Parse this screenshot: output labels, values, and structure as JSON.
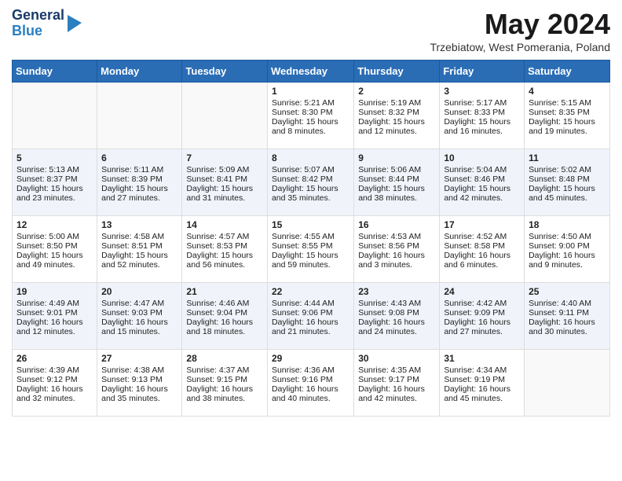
{
  "header": {
    "logo_general": "General",
    "logo_blue": "Blue",
    "title": "May 2024",
    "location": "Trzebiatow, West Pomerania, Poland"
  },
  "columns": [
    "Sunday",
    "Monday",
    "Tuesday",
    "Wednesday",
    "Thursday",
    "Friday",
    "Saturday"
  ],
  "weeks": [
    [
      {
        "day": "",
        "lines": []
      },
      {
        "day": "",
        "lines": []
      },
      {
        "day": "",
        "lines": []
      },
      {
        "day": "1",
        "lines": [
          "Sunrise: 5:21 AM",
          "Sunset: 8:30 PM",
          "Daylight: 15 hours",
          "and 8 minutes."
        ]
      },
      {
        "day": "2",
        "lines": [
          "Sunrise: 5:19 AM",
          "Sunset: 8:32 PM",
          "Daylight: 15 hours",
          "and 12 minutes."
        ]
      },
      {
        "day": "3",
        "lines": [
          "Sunrise: 5:17 AM",
          "Sunset: 8:33 PM",
          "Daylight: 15 hours",
          "and 16 minutes."
        ]
      },
      {
        "day": "4",
        "lines": [
          "Sunrise: 5:15 AM",
          "Sunset: 8:35 PM",
          "Daylight: 15 hours",
          "and 19 minutes."
        ]
      }
    ],
    [
      {
        "day": "5",
        "lines": [
          "Sunrise: 5:13 AM",
          "Sunset: 8:37 PM",
          "Daylight: 15 hours",
          "and 23 minutes."
        ]
      },
      {
        "day": "6",
        "lines": [
          "Sunrise: 5:11 AM",
          "Sunset: 8:39 PM",
          "Daylight: 15 hours",
          "and 27 minutes."
        ]
      },
      {
        "day": "7",
        "lines": [
          "Sunrise: 5:09 AM",
          "Sunset: 8:41 PM",
          "Daylight: 15 hours",
          "and 31 minutes."
        ]
      },
      {
        "day": "8",
        "lines": [
          "Sunrise: 5:07 AM",
          "Sunset: 8:42 PM",
          "Daylight: 15 hours",
          "and 35 minutes."
        ]
      },
      {
        "day": "9",
        "lines": [
          "Sunrise: 5:06 AM",
          "Sunset: 8:44 PM",
          "Daylight: 15 hours",
          "and 38 minutes."
        ]
      },
      {
        "day": "10",
        "lines": [
          "Sunrise: 5:04 AM",
          "Sunset: 8:46 PM",
          "Daylight: 15 hours",
          "and 42 minutes."
        ]
      },
      {
        "day": "11",
        "lines": [
          "Sunrise: 5:02 AM",
          "Sunset: 8:48 PM",
          "Daylight: 15 hours",
          "and 45 minutes."
        ]
      }
    ],
    [
      {
        "day": "12",
        "lines": [
          "Sunrise: 5:00 AM",
          "Sunset: 8:50 PM",
          "Daylight: 15 hours",
          "and 49 minutes."
        ]
      },
      {
        "day": "13",
        "lines": [
          "Sunrise: 4:58 AM",
          "Sunset: 8:51 PM",
          "Daylight: 15 hours",
          "and 52 minutes."
        ]
      },
      {
        "day": "14",
        "lines": [
          "Sunrise: 4:57 AM",
          "Sunset: 8:53 PM",
          "Daylight: 15 hours",
          "and 56 minutes."
        ]
      },
      {
        "day": "15",
        "lines": [
          "Sunrise: 4:55 AM",
          "Sunset: 8:55 PM",
          "Daylight: 15 hours",
          "and 59 minutes."
        ]
      },
      {
        "day": "16",
        "lines": [
          "Sunrise: 4:53 AM",
          "Sunset: 8:56 PM",
          "Daylight: 16 hours",
          "and 3 minutes."
        ]
      },
      {
        "day": "17",
        "lines": [
          "Sunrise: 4:52 AM",
          "Sunset: 8:58 PM",
          "Daylight: 16 hours",
          "and 6 minutes."
        ]
      },
      {
        "day": "18",
        "lines": [
          "Sunrise: 4:50 AM",
          "Sunset: 9:00 PM",
          "Daylight: 16 hours",
          "and 9 minutes."
        ]
      }
    ],
    [
      {
        "day": "19",
        "lines": [
          "Sunrise: 4:49 AM",
          "Sunset: 9:01 PM",
          "Daylight: 16 hours",
          "and 12 minutes."
        ]
      },
      {
        "day": "20",
        "lines": [
          "Sunrise: 4:47 AM",
          "Sunset: 9:03 PM",
          "Daylight: 16 hours",
          "and 15 minutes."
        ]
      },
      {
        "day": "21",
        "lines": [
          "Sunrise: 4:46 AM",
          "Sunset: 9:04 PM",
          "Daylight: 16 hours",
          "and 18 minutes."
        ]
      },
      {
        "day": "22",
        "lines": [
          "Sunrise: 4:44 AM",
          "Sunset: 9:06 PM",
          "Daylight: 16 hours",
          "and 21 minutes."
        ]
      },
      {
        "day": "23",
        "lines": [
          "Sunrise: 4:43 AM",
          "Sunset: 9:08 PM",
          "Daylight: 16 hours",
          "and 24 minutes."
        ]
      },
      {
        "day": "24",
        "lines": [
          "Sunrise: 4:42 AM",
          "Sunset: 9:09 PM",
          "Daylight: 16 hours",
          "and 27 minutes."
        ]
      },
      {
        "day": "25",
        "lines": [
          "Sunrise: 4:40 AM",
          "Sunset: 9:11 PM",
          "Daylight: 16 hours",
          "and 30 minutes."
        ]
      }
    ],
    [
      {
        "day": "26",
        "lines": [
          "Sunrise: 4:39 AM",
          "Sunset: 9:12 PM",
          "Daylight: 16 hours",
          "and 32 minutes."
        ]
      },
      {
        "day": "27",
        "lines": [
          "Sunrise: 4:38 AM",
          "Sunset: 9:13 PM",
          "Daylight: 16 hours",
          "and 35 minutes."
        ]
      },
      {
        "day": "28",
        "lines": [
          "Sunrise: 4:37 AM",
          "Sunset: 9:15 PM",
          "Daylight: 16 hours",
          "and 38 minutes."
        ]
      },
      {
        "day": "29",
        "lines": [
          "Sunrise: 4:36 AM",
          "Sunset: 9:16 PM",
          "Daylight: 16 hours",
          "and 40 minutes."
        ]
      },
      {
        "day": "30",
        "lines": [
          "Sunrise: 4:35 AM",
          "Sunset: 9:17 PM",
          "Daylight: 16 hours",
          "and 42 minutes."
        ]
      },
      {
        "day": "31",
        "lines": [
          "Sunrise: 4:34 AM",
          "Sunset: 9:19 PM",
          "Daylight: 16 hours",
          "and 45 minutes."
        ]
      },
      {
        "day": "",
        "lines": []
      }
    ]
  ]
}
